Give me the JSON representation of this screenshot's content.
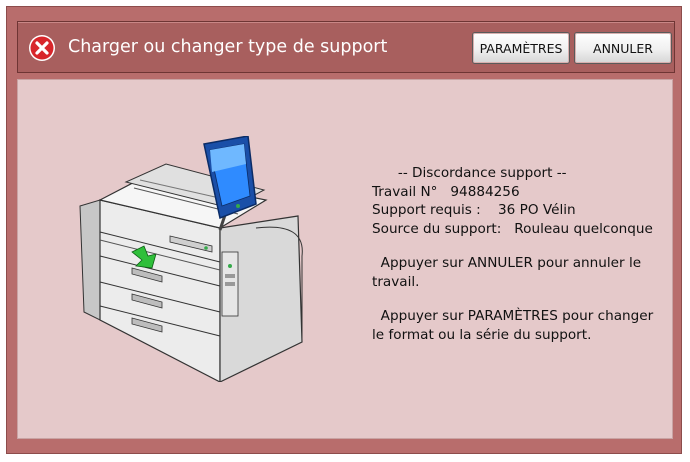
{
  "dialog": {
    "title": "Charger ou changer type de support",
    "icon": "error-icon",
    "colors": {
      "frame": "#b86d6c",
      "panel": "#e5c9ca",
      "error": "#d8262b"
    }
  },
  "buttons": {
    "params_label": "PARAMÈTRES",
    "cancel_label": "ANNULER"
  },
  "message": {
    "header": "      -- Discordance support --",
    "job": "Travail N°   94884256",
    "required": "Support requis :    36 PO Vélin",
    "source": "Source du support:   Rouleau quelconque",
    "cancel_line1": "  Appuyer sur ANNULER pour annuler le",
    "cancel_line2": "travail.",
    "params_line1": "  Appuyer sur PARAMÈTRES pour changer",
    "params_line2": "le format ou la série du support."
  },
  "illustration": {
    "icon": "printer-illustration-icon"
  }
}
